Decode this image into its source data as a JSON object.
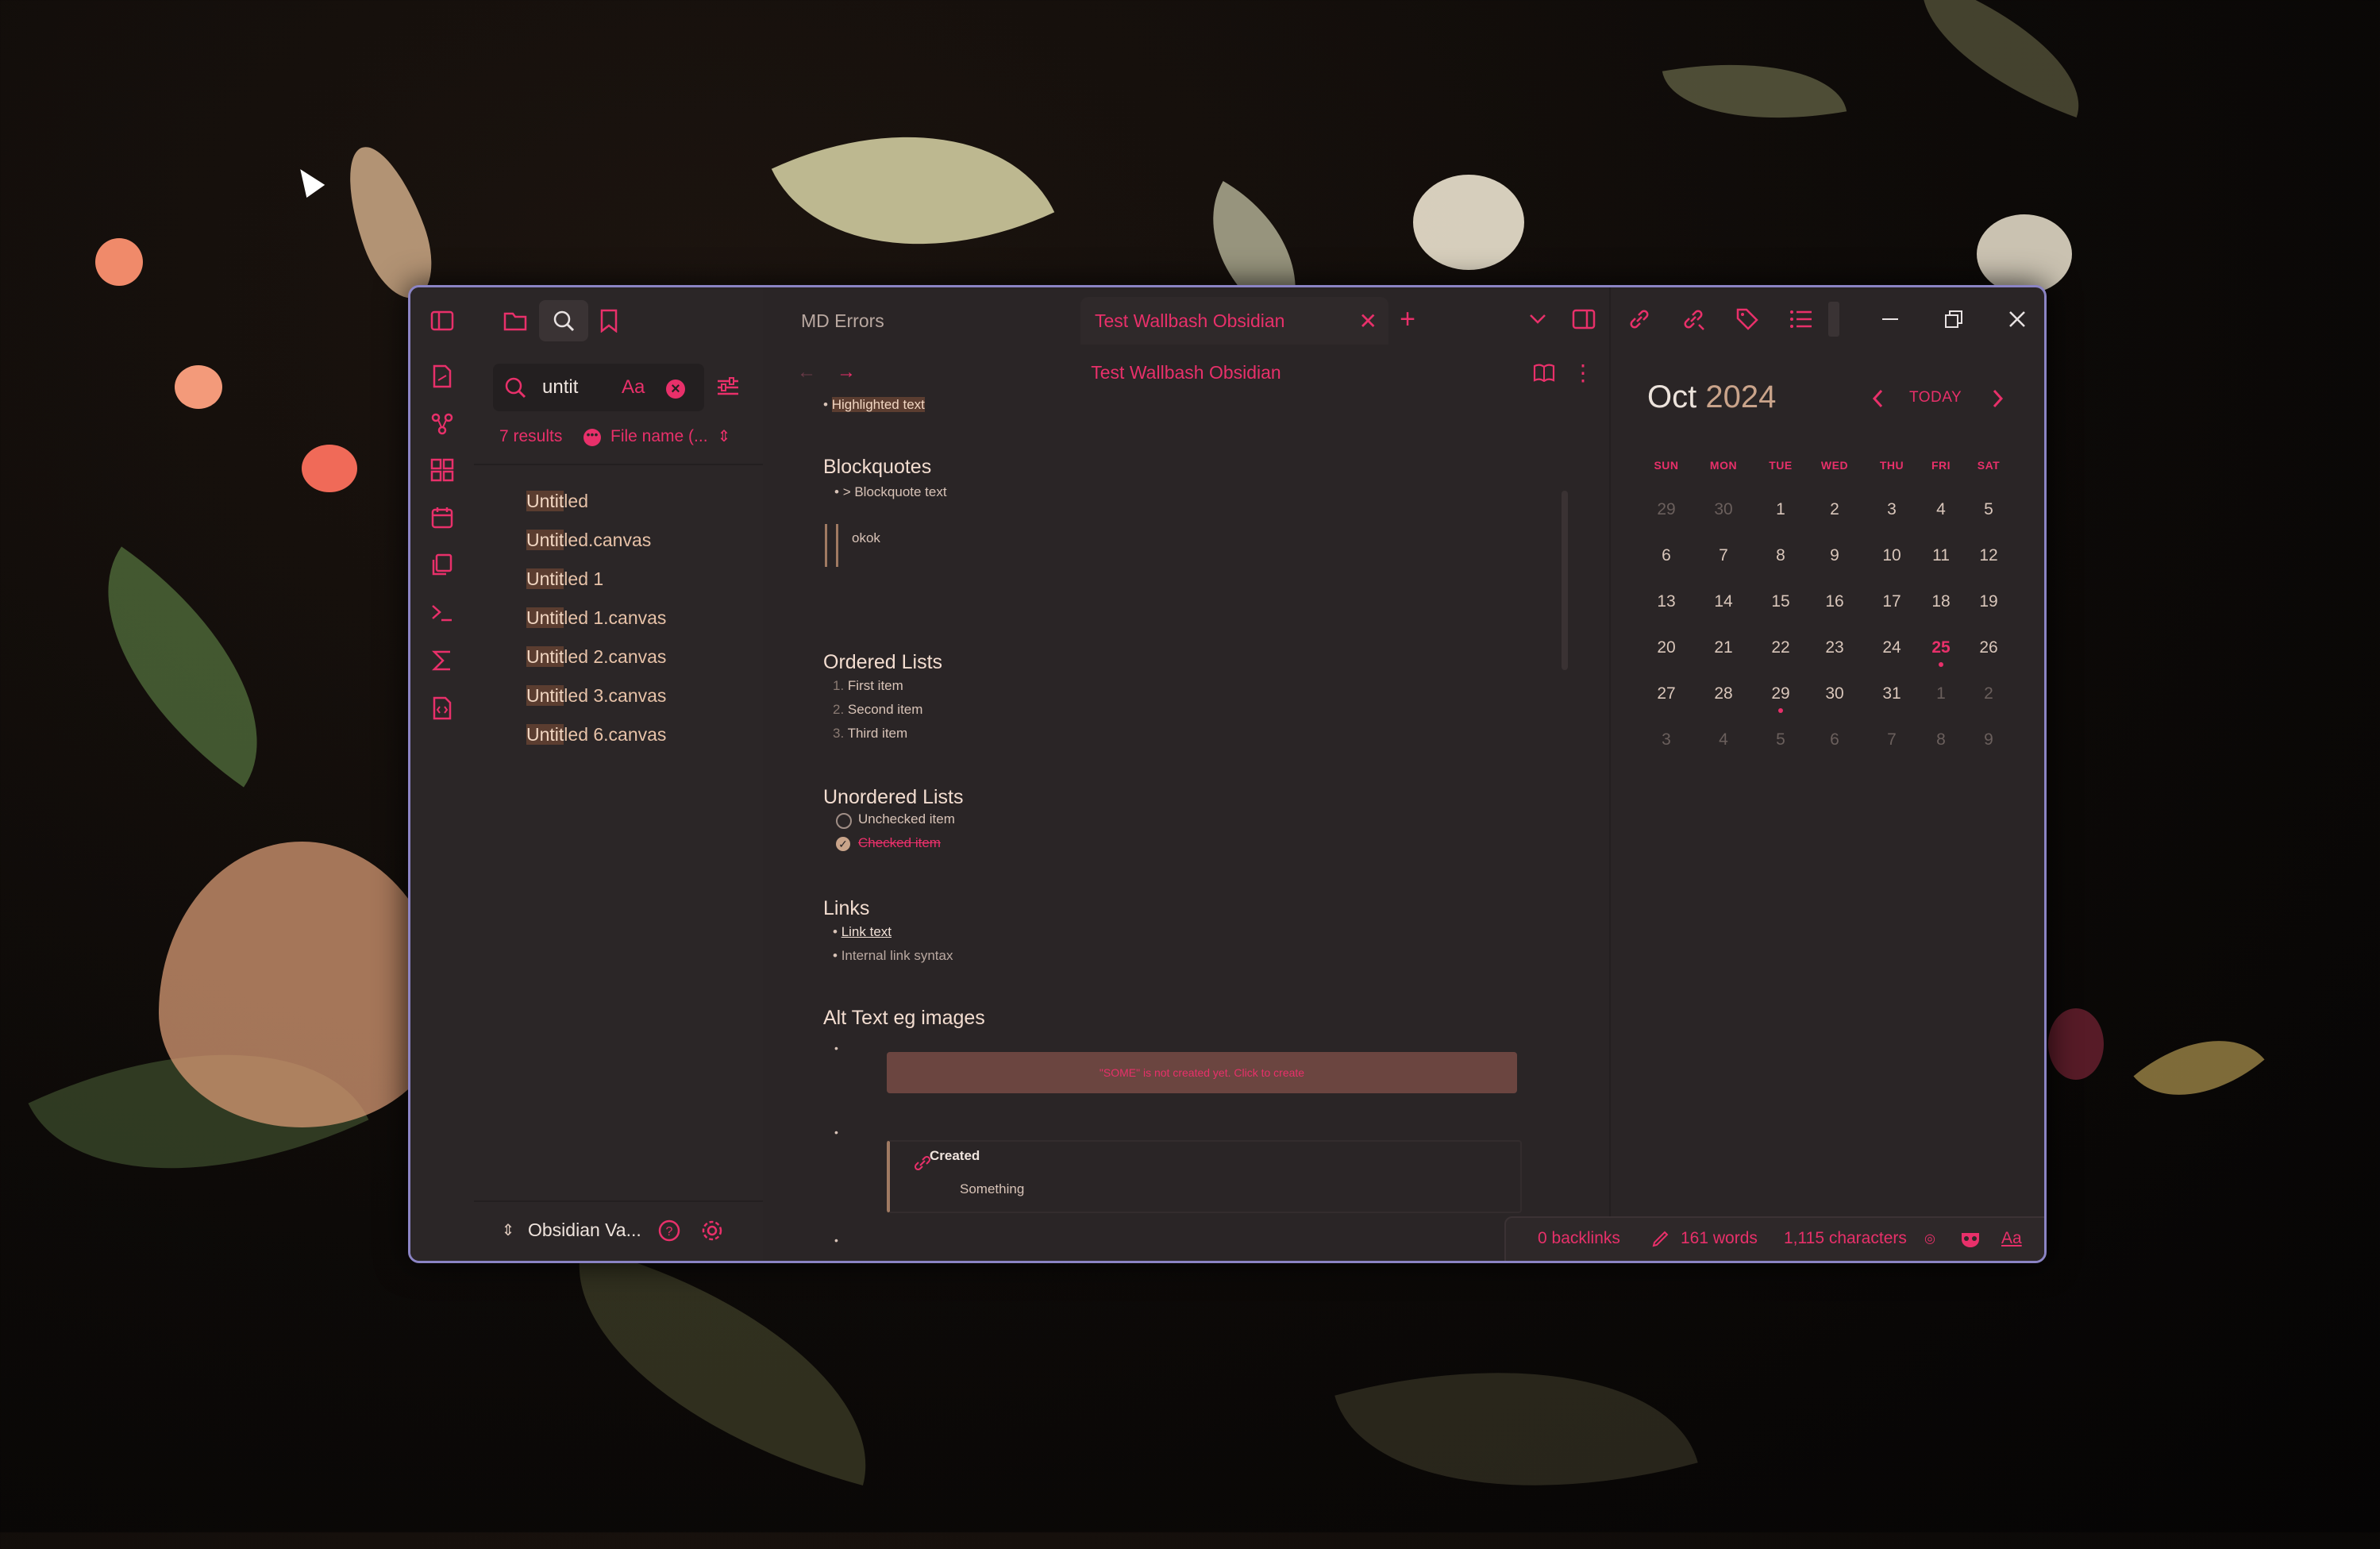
{
  "colors": {
    "accent": "#e8306a",
    "window_border": "#8b84c4",
    "bg": "#2a2526",
    "text": "#d8c3b7"
  },
  "tabs": [
    {
      "label": "MD Errors",
      "active": false
    },
    {
      "label": "Test Wallbash Obsidian",
      "active": true
    }
  ],
  "search": {
    "query": "untit",
    "case_label": "Aa",
    "results_count": "7 results",
    "sort_label": "File name (..."
  },
  "results": [
    {
      "prefix": "Untit",
      "rest": "led"
    },
    {
      "prefix": "Untit",
      "rest": "led.canvas"
    },
    {
      "prefix": "Untit",
      "rest": "led 1"
    },
    {
      "prefix": "Untit",
      "rest": "led 1.canvas"
    },
    {
      "prefix": "Untit",
      "rest": "led 2.canvas"
    },
    {
      "prefix": "Untit",
      "rest": "led 3.canvas"
    },
    {
      "prefix": "Untit",
      "rest": "led 6.canvas"
    }
  ],
  "vault": {
    "name": "Obsidian Va..."
  },
  "editor": {
    "title": "Test Wallbash Obsidian",
    "highlighted": "Highlighted text",
    "h_blockquotes": "Blockquotes",
    "blockquote_item": "> Blockquote text",
    "blockquote_content": "okok",
    "h_ordered": "Ordered Lists",
    "ordered": [
      "First item",
      "Second item",
      "Third item"
    ],
    "h_unordered": "Unordered Lists",
    "unchecked": "Unchecked item",
    "checked": "Checked item",
    "h_links": "Links",
    "link_text": "Link text",
    "internal_link": "Internal link syntax",
    "h_alt": "Alt Text eg images",
    "not_created": "\"SOME\" is not created yet. Click to create",
    "embed_title": "Created",
    "embed_body": "Something"
  },
  "calendar": {
    "month": "Oct",
    "year": "2024",
    "today_label": "TODAY",
    "weekdays": [
      "SUN",
      "MON",
      "TUE",
      "WED",
      "THU",
      "FRI",
      "SAT"
    ],
    "weeks": [
      [
        "29",
        "30",
        "1",
        "2",
        "3",
        "4",
        "5"
      ],
      [
        "6",
        "7",
        "8",
        "9",
        "10",
        "11",
        "12"
      ],
      [
        "13",
        "14",
        "15",
        "16",
        "17",
        "18",
        "19"
      ],
      [
        "20",
        "21",
        "22",
        "23",
        "24",
        "25",
        "26"
      ],
      [
        "27",
        "28",
        "29",
        "30",
        "31",
        "1",
        "2"
      ],
      [
        "3",
        "4",
        "5",
        "6",
        "7",
        "8",
        "9"
      ]
    ]
  },
  "status": {
    "backlinks": "0 backlinks",
    "words": "161 words",
    "characters": "1,115 characters",
    "font_label": "Aa"
  },
  "icons": [
    "sidebar-toggle-icon",
    "folder-icon",
    "search-icon",
    "bookmark-icon",
    "file-icon",
    "graph-icon",
    "grid-icon",
    "calendar-icon",
    "copy-icon",
    "terminal-icon",
    "sigma-icon",
    "code-file-icon",
    "plus-icon",
    "chevron-down-icon",
    "split-icon",
    "link-icon",
    "tag-icon",
    "list-icon",
    "minimize-icon",
    "restore-icon",
    "close-icon",
    "book-icon",
    "more-icon",
    "help-icon",
    "gear-icon",
    "pencil-icon",
    "mask-icon"
  ]
}
